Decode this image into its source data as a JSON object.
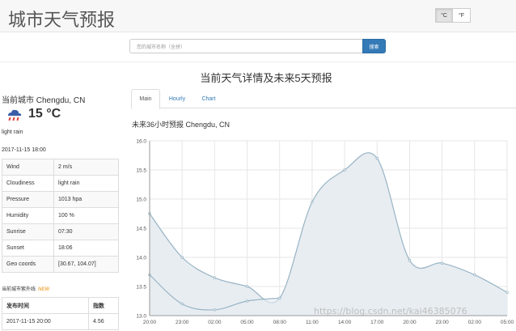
{
  "header": {
    "title": "城市天气预报",
    "unit_c": "°C",
    "unit_f": "°F"
  },
  "search": {
    "placeholder": "您的城市名称（全拼）",
    "button": "搜索"
  },
  "section_title": "当前天气详情及未来5天预报",
  "current": {
    "city_label": "当前城市 Chengdu, CN",
    "temperature": "15 °C",
    "description": "light rain",
    "time": "2017-11-15 18:00",
    "details": [
      {
        "label": "Wind",
        "value": "2 m/s"
      },
      {
        "label": "Cloudiness",
        "value": "light rain"
      },
      {
        "label": "Pressure",
        "value": "1013 hpa"
      },
      {
        "label": "Humidity",
        "value": "100 %"
      },
      {
        "label": "Sunrise",
        "value": "07:30"
      },
      {
        "label": "Sunset",
        "value": "18:06"
      },
      {
        "label": "Geo coords",
        "value": "[30.67, 104.07]"
      }
    ]
  },
  "uv": {
    "title": "当前城市紫外线",
    "badge": "NEW",
    "header_time": "发布时间",
    "header_index": "指数",
    "time": "2017-11-15 20:00",
    "index": "4.56"
  },
  "tabs": [
    "Main",
    "Hourly",
    "Chart"
  ],
  "chart_title": "未来36小时预报 Chengdu, CN",
  "chart_data": {
    "type": "area",
    "categories": [
      "20:00",
      "23:00",
      "02:00",
      "05:00",
      "08:00",
      "11:00",
      "14:00",
      "17:00",
      "20:00",
      "23:00",
      "02:00",
      "05:00"
    ],
    "series": [
      {
        "values": [
          14.75,
          14.0,
          13.65,
          13.5,
          13.3,
          14.95,
          15.5,
          15.7,
          13.95,
          13.9,
          13.7,
          13.4
        ]
      },
      {
        "values": [
          13.7,
          13.2,
          13.1,
          13.25,
          13.3,
          null,
          null,
          null,
          null,
          null,
          null,
          null
        ]
      }
    ],
    "ylim": [
      13.0,
      16.0
    ],
    "yticks": [
      "13.0",
      "13.5",
      "14.0",
      "14.5",
      "15.0",
      "15.5",
      "16.0"
    ],
    "grid": true,
    "colors": {
      "line": "#98b4c5",
      "fill": "#e8edf1"
    }
  },
  "watermark": "https://blog.csdn.net/kai46385076"
}
